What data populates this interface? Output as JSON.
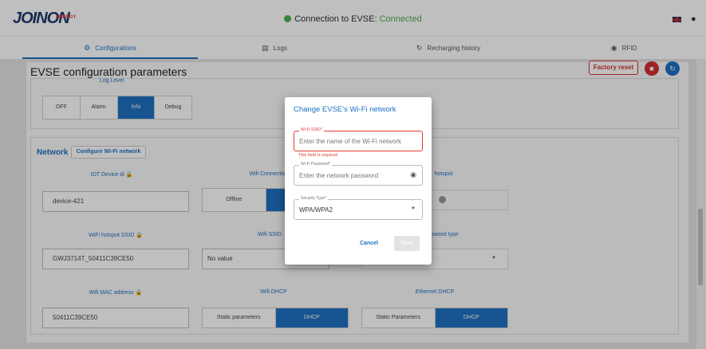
{
  "header": {
    "logo": "JOINON",
    "logo_sub": "ENERGY",
    "connection_label": "Connection to EVSE:",
    "connection_status": "Connected",
    "accent_color": "#1e70c2",
    "status_color": "#4caf50"
  },
  "tabs": [
    {
      "label": "Configurations",
      "icon": "gear-icon",
      "active": true
    },
    {
      "label": "Logs",
      "icon": "logs-icon",
      "active": false
    },
    {
      "label": "Recharging history",
      "icon": "history-icon",
      "active": false
    },
    {
      "label": "RFID",
      "icon": "rfid-icon",
      "active": false
    }
  ],
  "page": {
    "title": "EVSE configuration parameters",
    "factory_reset": "Factory reset"
  },
  "log_level": {
    "label": "Log Level",
    "options": [
      "OFF",
      "Alarm",
      "Info",
      "Debug"
    ],
    "selected": "Info"
  },
  "network": {
    "title": "Network",
    "configure_wifi": "Configure Wi-Fi network",
    "iot_device_id_label": "IOT Device id",
    "iot_device_id": "device-421",
    "wifi_connection_label": "Wifi Connection",
    "wifi_connection_option": "Offline",
    "hotspot_label": "hotspot",
    "wifi_hotspot_ssid_label": "WiFi hotspot SSID",
    "wifi_hotspot_ssid": "GWJ3714T_50411C39CE50",
    "wifi_ssid_label": "Wifi SSID",
    "wifi_ssid": "No value",
    "password_type_label": "sword type",
    "wifi_mac_label": "Wifi MAC address",
    "wifi_mac": "50411C39CE50",
    "wifi_dhcp_label": "Wifi DHCP",
    "wifi_dhcp_options": [
      "Static parameters",
      "DHCP"
    ],
    "ethernet_dhcp_label": "Ethernet DHCP",
    "ethernet_dhcp_options": [
      "Static Parameters",
      "DHCP"
    ]
  },
  "dialog": {
    "title": "Change EVSE's Wi-Fi network",
    "ssid_label": "Wi-Fi SSID*",
    "ssid_placeholder": "Enter the name of the Wi-Fi network",
    "ssid_error": "This field is required",
    "password_label": "Wi-Fi Password*",
    "password_placeholder": "Enter the network password",
    "security_label": "Security Type*",
    "security_value": "WPA/WPA2",
    "cancel": "Cancel",
    "save": "Save"
  }
}
